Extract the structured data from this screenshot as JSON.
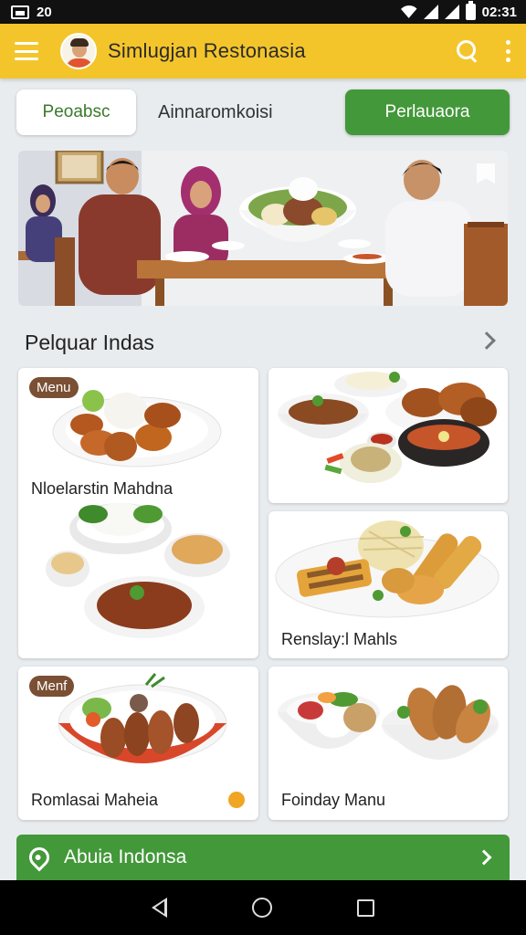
{
  "status_bar": {
    "notification_count": "20",
    "time": "02:31"
  },
  "app_bar": {
    "title": "Simlugjan  Restonasia"
  },
  "tabs": {
    "outlined_label": "Peoabsc",
    "plain_label": "Ainnaromkoisi",
    "green_label": "Perlauaora"
  },
  "section": {
    "title": "Pelquar Indas"
  },
  "cards": [
    {
      "badge": "Menu",
      "label": "Nloelarstin Mahdna"
    },
    {
      "label": ""
    },
    {
      "label": "Renslay:l Mahls"
    },
    {
      "badge": "Menf",
      "label": "Romlasai Maheia"
    },
    {
      "label": "Foinday Manu"
    }
  ],
  "action_bar": {
    "label": "Abuia Indonsa"
  },
  "colors": {
    "app_bar": "#f4c52a",
    "primary_green": "#43983a",
    "badge_brown": "#7a4f33"
  }
}
